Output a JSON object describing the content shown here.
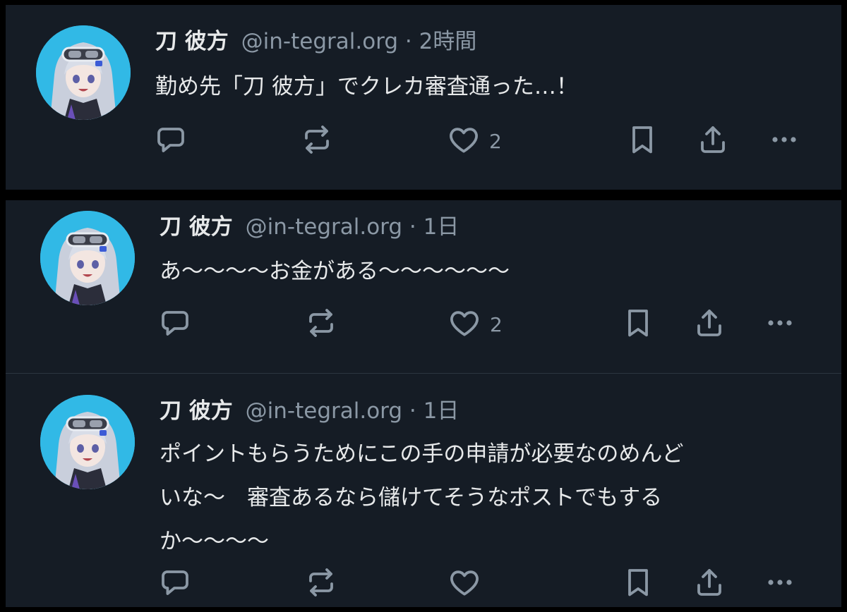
{
  "colors": {
    "background": "#151c25",
    "text_primary": "#e7e9ea",
    "text_secondary": "#8b98a5",
    "avatar_bg": "#31b9e6"
  },
  "tweets": [
    {
      "name": "刀 彼方",
      "handle": "@in-tegral.org",
      "time": "· 2時間",
      "text": "勤め先「刀 彼方」でクレカ審査通った…！",
      "like_count": "2",
      "icons": [
        "reply-icon",
        "retweet-icon",
        "like-icon",
        "bookmark-icon",
        "share-icon",
        "more-icon"
      ]
    },
    {
      "name": "刀 彼方",
      "handle": "@in-tegral.org",
      "time": "· 1日",
      "text": "あ〜〜〜〜お金がある〜〜〜〜〜〜",
      "like_count": "2",
      "icons": [
        "reply-icon",
        "retweet-icon",
        "like-icon",
        "bookmark-icon",
        "share-icon",
        "more-icon"
      ]
    },
    {
      "name": "刀 彼方",
      "handle": "@in-tegral.org",
      "time": "· 1日",
      "text": "ポイントもらうためにこの手の申請が必要なのめんど\nいな〜　審査あるなら儲けてそうなポストでもする\nか〜〜〜〜",
      "like_count": "",
      "icons": [
        "reply-icon",
        "retweet-icon",
        "like-icon",
        "bookmark-icon",
        "share-icon",
        "more-icon"
      ]
    }
  ]
}
